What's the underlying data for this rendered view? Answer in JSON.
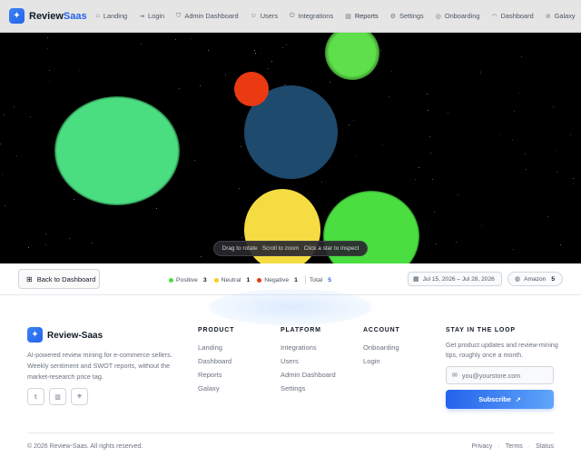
{
  "brand": {
    "name_main": "Review",
    "name_accent": "Saas"
  },
  "nav": {
    "items": [
      {
        "label": "Landing",
        "icon": "home-icon"
      },
      {
        "label": "Login",
        "icon": "login-icon"
      },
      {
        "label": "Admin Dashboard",
        "icon": "shield-icon"
      },
      {
        "label": "Users",
        "icon": "users-icon"
      },
      {
        "label": "Integrations",
        "icon": "plug-icon"
      },
      {
        "label": "Reports",
        "icon": "file-icon"
      },
      {
        "label": "Settings",
        "icon": "gear-icon"
      },
      {
        "label": "Onboarding",
        "icon": "compass-icon"
      },
      {
        "label": "Dashboard",
        "icon": "gauge-icon"
      },
      {
        "label": "Galaxy",
        "icon": "orbit-icon"
      }
    ],
    "active": "Reports"
  },
  "viewport": {
    "hints": [
      "Drag to rotate",
      "Scroll to zoom",
      "Click a star to inspect"
    ],
    "orb_colors": {
      "positive": "#4ade80",
      "neutral": "#facc15",
      "negative": "#ea3a12",
      "core": "#1e4a6e"
    }
  },
  "toolbar": {
    "back_label": "Back to Dashboard",
    "legend": {
      "positive_label": "Positive",
      "positive_count": "3",
      "neutral_label": "Neutral",
      "neutral_count": "1",
      "negative_label": "Negative",
      "negative_count": "1",
      "total_label": "Total",
      "total_count": "5"
    },
    "date_range": "Jul 15, 2026 – Jul 28, 2026",
    "store": {
      "label": "Amazon",
      "count": "5"
    }
  },
  "footer": {
    "brand": "Review-Saas",
    "description": "AI-powered review mining for e-commerce sellers. Weekly sentiment and SWOT reports, without the market-research price tag.",
    "columns": [
      {
        "title": "PRODUCT",
        "links": [
          "Landing",
          "Dashboard",
          "Reports",
          "Galaxy"
        ]
      },
      {
        "title": "PLATFORM",
        "links": [
          "Integrations",
          "Users",
          "Admin Dashboard",
          "Settings"
        ]
      },
      {
        "title": "ACCOUNT",
        "links": [
          "Onboarding",
          "Login"
        ]
      }
    ],
    "newsletter": {
      "title": "STAY IN THE LOOP",
      "description": "Get product updates and review-mining tips, roughly once a month.",
      "placeholder": "you@yourstore.com",
      "button": "Subscribe"
    },
    "copyright": "© 2026 Review-Saas. All rights reserved.",
    "bottom_links": [
      "Privacy",
      "Terms",
      "Status"
    ]
  }
}
